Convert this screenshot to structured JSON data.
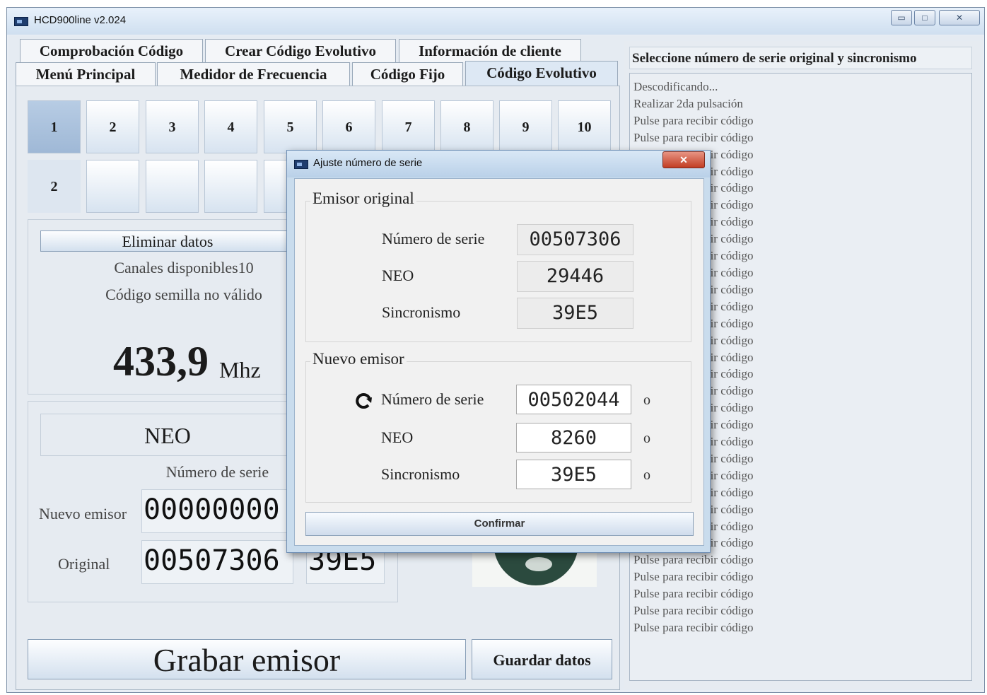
{
  "window": {
    "title": "HCD900line v2.024",
    "minimize": "▭",
    "maximize": "□",
    "close": "✕"
  },
  "tabs_row1": [
    "Comprobación Código",
    "Crear Código Evolutivo",
    "Información de cliente"
  ],
  "tabs_row2": [
    "Menú Principal",
    "Medidor de Frecuencia",
    "Código Fijo",
    "Código Evolutivo"
  ],
  "channels": [
    "1",
    "2",
    "3",
    "4",
    "5",
    "6",
    "7",
    "8",
    "9",
    "10"
  ],
  "channels_row2": [
    "2"
  ],
  "left": {
    "delete_btn": "Eliminar datos",
    "channels_available": "Canales disponibles10",
    "seed_status": "Código semilla no válido",
    "freq_value": "433,9",
    "freq_unit": "Mhz",
    "neo_label": "NEO",
    "serial_header": "Número de serie",
    "new_label": "Nuevo emisor",
    "new_serial": "00000000",
    "orig_label": "Original",
    "orig_serial": "00507306",
    "orig_sync": "39E5",
    "record_btn": "Grabar emisor",
    "save_btn": "Guardar datos"
  },
  "right": {
    "header": "Seleccione número de serie original y sincronismo",
    "log": [
      "Descodificando...",
      "Realizar 2da pulsación",
      "Pulse para recibir código",
      "Pulse para recibir código",
      "Pulse para recibir código",
      "Pulse para recibir código",
      "Pulse para recibir código",
      "Pulse para recibir código",
      "Pulse para recibir código",
      "Pulse para recibir código",
      "Pulse para recibir código",
      "Pulse para recibir código",
      "Pulse para recibir código",
      "Pulse para recibir código",
      "Pulse para recibir código",
      "Pulse para recibir código",
      "Pulse para recibir código",
      "Pulse para recibir código",
      "Pulse para recibir código",
      "Pulse para recibir código",
      "Pulse para recibir código",
      "Pulse para recibir código",
      "Pulse para recibir código",
      "Pulse para recibir código",
      "Pulse para recibir código",
      "Pulse para recibir código",
      "Pulse para recibir código",
      "Pulse para recibir código",
      "Pulse para recibir código",
      "Pulse para recibir código",
      "Pulse para recibir código",
      "Pulse para recibir código",
      "Pulse para recibir código"
    ]
  },
  "dialog": {
    "title": "Ajuste número de serie",
    "close": "✕",
    "original_group": "Emisor original",
    "new_group": "Nuevo emisor",
    "serial_label": "Número de serie",
    "neo_label": "NEO",
    "sync_label": "Sincronismo",
    "orig_serial": "00507306",
    "orig_neo": "29446",
    "orig_sync": "39E5",
    "new_serial": "00502044",
    "new_neo": "8260",
    "new_sync": "39E5",
    "suffix": "o",
    "confirm": "Confirmar"
  }
}
